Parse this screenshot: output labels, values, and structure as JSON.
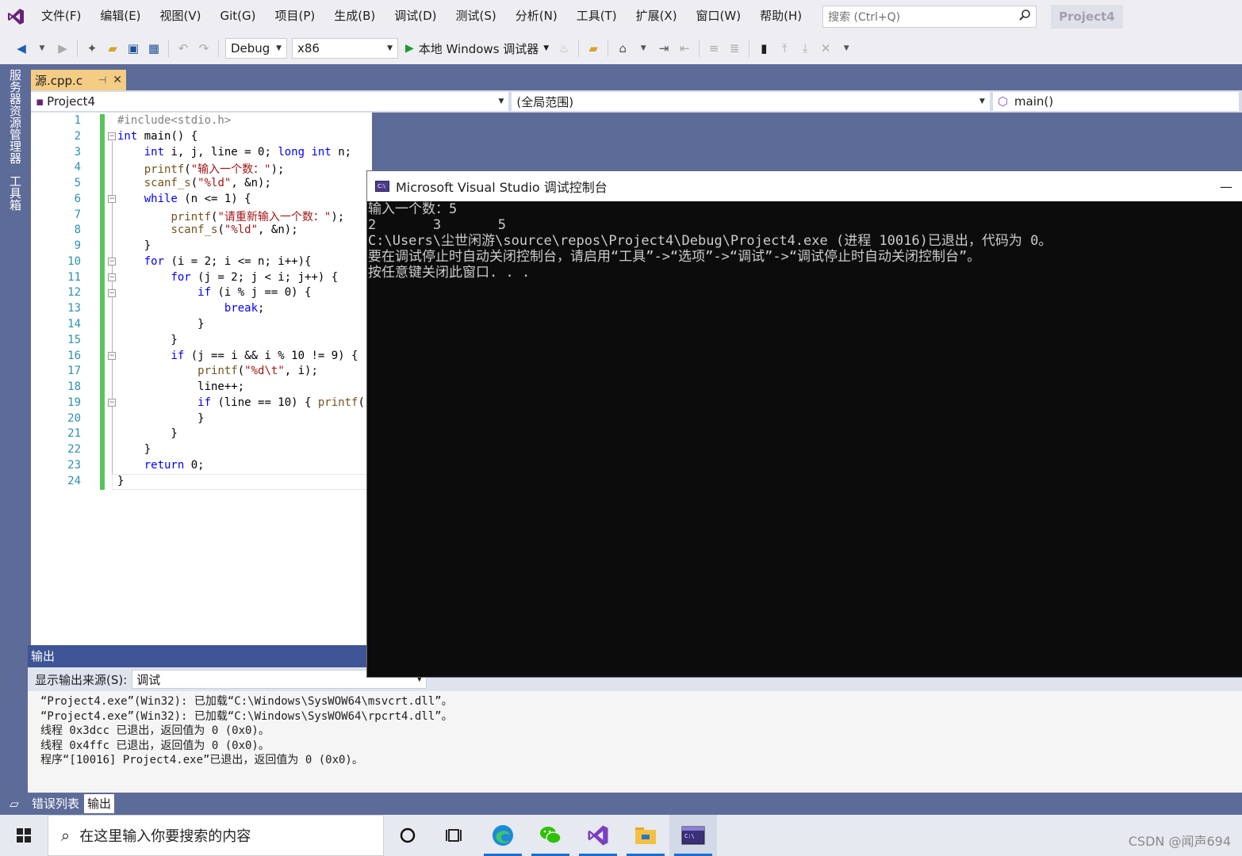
{
  "menu": [
    "文件(F)",
    "编辑(E)",
    "视图(V)",
    "Git(G)",
    "项目(P)",
    "生成(B)",
    "调试(D)",
    "测试(S)",
    "分析(N)",
    "工具(T)",
    "扩展(X)",
    "窗口(W)",
    "帮助(H)"
  ],
  "search": {
    "placeholder": "搜索 (Ctrl+Q)"
  },
  "project_name": "Project4",
  "toolbar": {
    "config": "Debug",
    "platform": "x86",
    "run_label": "本地 Windows 调试器"
  },
  "left_tabs": [
    "服务器资源管理器",
    "工具箱"
  ],
  "doc_tab": {
    "title": "源.cpp.c"
  },
  "navbar": {
    "project": "Project4",
    "scope": "(全局范围)",
    "member": "main()"
  },
  "editor": {
    "line_numbers": [
      "1",
      "2",
      "3",
      "4",
      "5",
      "6",
      "7",
      "8",
      "9",
      "10",
      "11",
      "12",
      "13",
      "14",
      "15",
      "16",
      "17",
      "18",
      "19",
      "20",
      "21",
      "22",
      "23",
      "24"
    ]
  },
  "console": {
    "title": "Microsoft Visual Studio 调试控制台",
    "lines": [
      "输入一个数：5",
      "2       3       5",
      "C:\\Users\\尘世闲游\\source\\repos\\Project4\\Debug\\Project4.exe (进程 10016)已退出，代码为 0。",
      "要在调试停止时自动关闭控制台，请启用“工具”->“选项”->“调试”->“调试停止时自动关闭控制台”。",
      "按任意键关闭此窗口. . ."
    ]
  },
  "output": {
    "header": "输出",
    "source_label": "显示输出来源(S):",
    "source_value": "调试",
    "lines": [
      "“Project4.exe”(Win32): 已加载“C:\\Windows\\SysWOW64\\msvcrt.dll”。",
      "“Project4.exe”(Win32): 已加载“C:\\Windows\\SysWOW64\\rpcrt4.dll”。",
      "线程 0x3dcc 已退出，返回值为 0 (0x0)。",
      "线程 0x4ffc 已退出，返回值为 0 (0x0)。",
      "程序“[10016] Project4.exe”已退出，返回值为 0 (0x0)。"
    ]
  },
  "bottom_tabs": [
    "错误列表",
    "输出"
  ],
  "taskbar": {
    "search_placeholder": "在这里输入你要搜索的内容"
  },
  "watermark": "CSDN @闻声694"
}
